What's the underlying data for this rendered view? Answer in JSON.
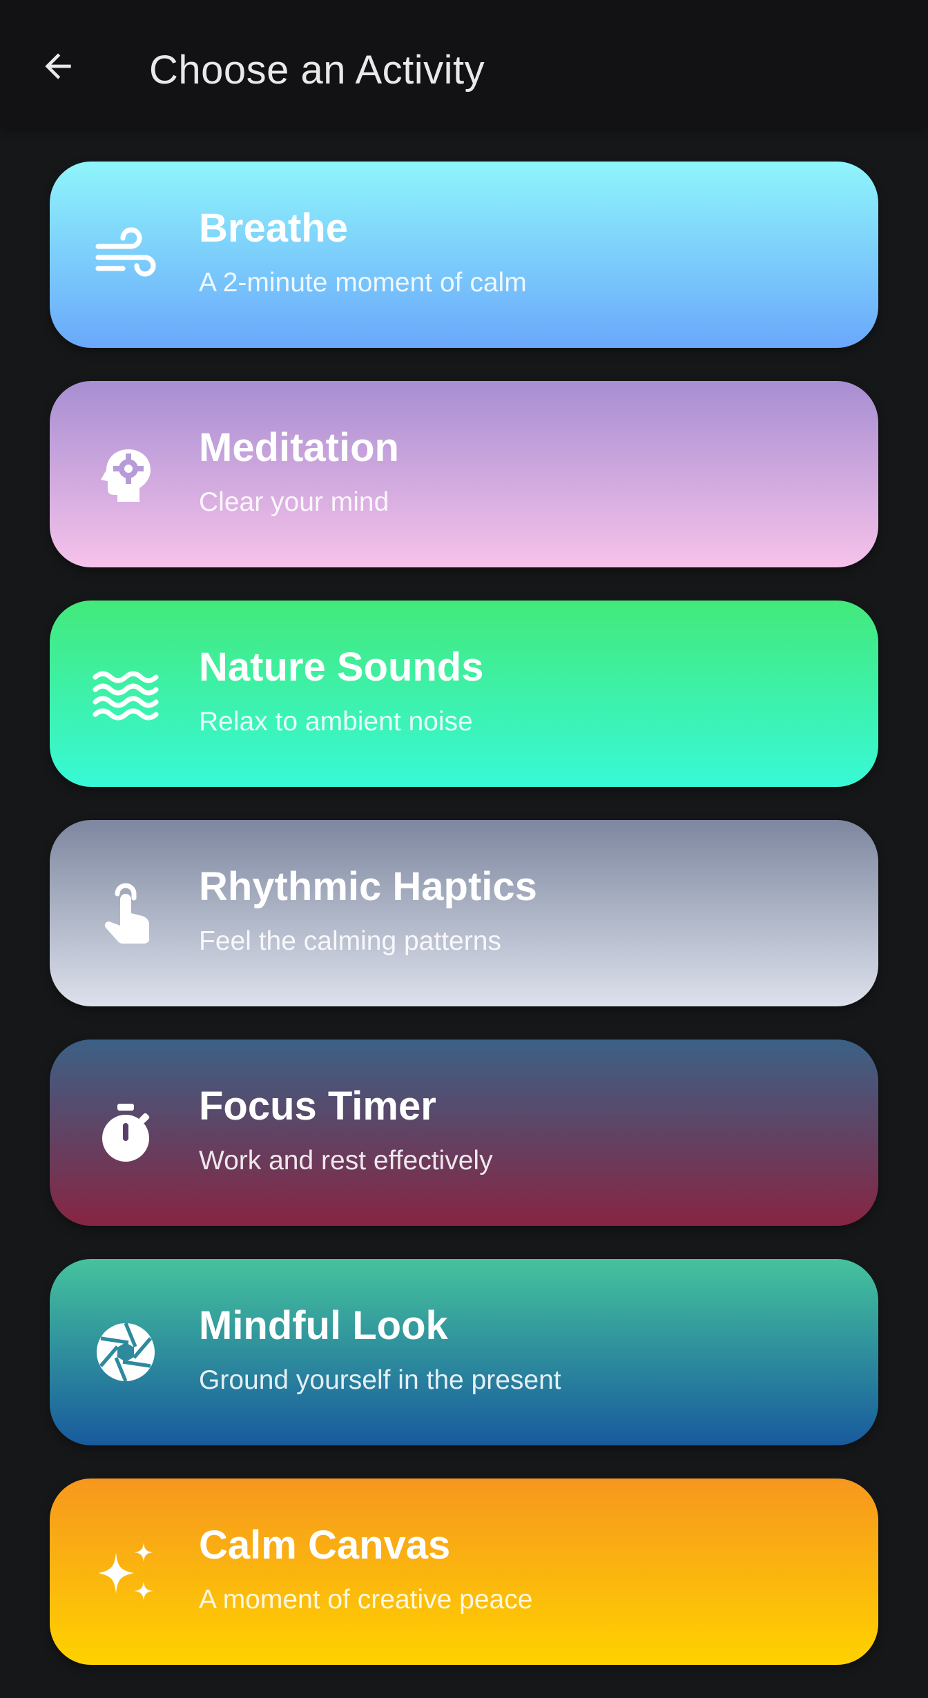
{
  "header": {
    "title": "Choose an Activity",
    "back_icon": "arrow-left-icon"
  },
  "activities": [
    {
      "title": "Breathe",
      "subtitle": "A 2-minute moment of calm",
      "icon": "wind-icon",
      "gradient": [
        "#8ff5fb",
        "#6aa8fb"
      ]
    },
    {
      "title": "Meditation",
      "subtitle": "Clear your mind",
      "icon": "head-gear-icon",
      "gradient": [
        "#a78ed2",
        "#f6c2ea"
      ]
    },
    {
      "title": "Nature Sounds",
      "subtitle": "Relax to ambient noise",
      "icon": "waves-icon",
      "gradient": [
        "#43e97b",
        "#38f9d7"
      ]
    },
    {
      "title": "Rhythmic Haptics",
      "subtitle": "Feel the calming patterns",
      "icon": "touch-finger-icon",
      "gradient": [
        "#7d879f",
        "#dde1ec"
      ]
    },
    {
      "title": "Focus Timer",
      "subtitle": "Work and rest effectively",
      "icon": "stopwatch-icon",
      "gradient": [
        "#3b6186",
        "#862542"
      ]
    },
    {
      "title": "Mindful Look",
      "subtitle": "Ground yourself in the present",
      "icon": "aperture-icon",
      "gradient": [
        "#45c39d",
        "#185a9d"
      ]
    },
    {
      "title": "Calm Canvas",
      "subtitle": "A moment of creative peace",
      "icon": "sparkles-icon",
      "gradient": [
        "#f7971e",
        "#ffd200"
      ]
    }
  ]
}
